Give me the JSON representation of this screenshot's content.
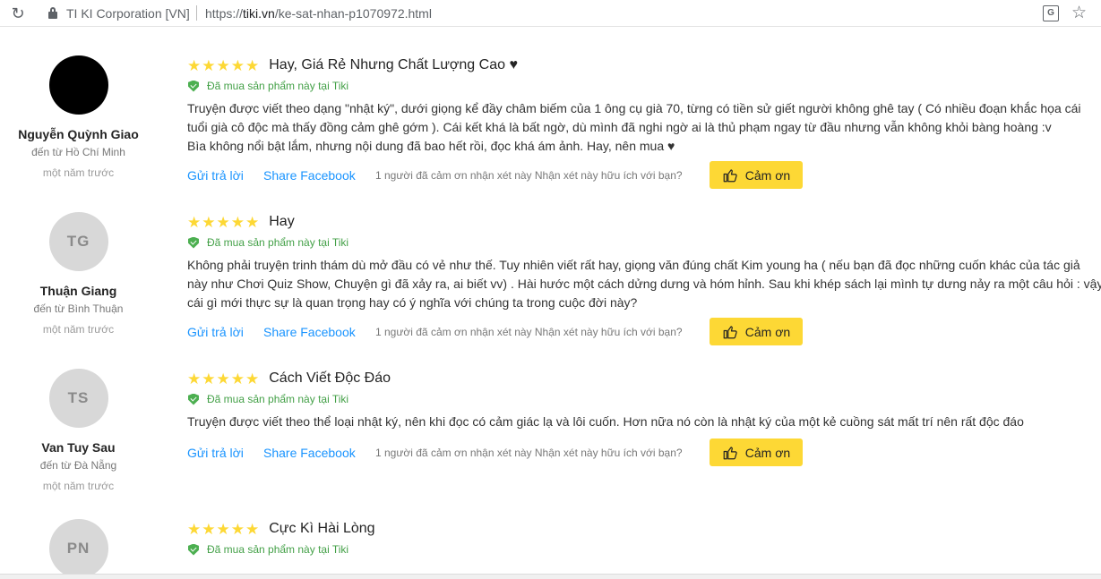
{
  "browser": {
    "site_name": "TI KI Corporation [VN]",
    "url_prefix": "https://",
    "url_host": "tiki.vn",
    "url_path": "/ke-sat-nhan-p1070972.html"
  },
  "labels": {
    "verified": "Đã mua sản phẩm này tại Tiki",
    "reply": "Gửi trả lời",
    "share": "Share Facebook",
    "thanks_button": "Cảm ơn"
  },
  "reviews": [
    {
      "author_initials": "",
      "author_name": "Nguyễn Quỳnh Giao",
      "author_from": "đến từ Hồ Chí Minh",
      "date": "một năm trước",
      "stars": "★★★★★",
      "rating": 5,
      "title": "Hay, Giá Rẻ Nhưng Chất Lượng Cao ♥",
      "body_lines": [
        "Truyện được viết theo dạng \"nhật ký\", dưới giọng kể đầy châm biếm của 1 ông cụ già 70, từng có tiền sử giết người không ghê tay ( Có nhiều đoạn khắc họa cái",
        "tuổi già cô độc mà thấy đồng cảm ghê gớm ). Cái kết khá là bất ngờ, dù mình đã nghi ngờ ai là thủ phạm ngay từ đầu nhưng vẫn không khỏi bàng hoàng :v",
        "Bìa không nổi bật lắm, nhưng nội dung đã bao hết rồi, đọc khá ám ảnh. Hay, nên mua ♥"
      ],
      "thanks_info": "1 người đã cảm ơn nhận xét này Nhận xét này hữu ích với bạn?"
    },
    {
      "author_initials": "TG",
      "author_name": "Thuận Giang",
      "author_from": "đến từ Bình Thuận",
      "date": "một năm trước",
      "stars": "★★★★★",
      "rating": 5,
      "title": "Hay",
      "body_lines": [
        "Không phải truyện trinh thám dù mở đầu có vẻ như thế. Tuy nhiên viết rất hay, giọng văn đúng chất Kim young ha ( nếu bạn đã đọc những cuốn khác của tác giả",
        "này như Chơi Quiz Show, Chuyện gì đã xảy ra, ai biết vv) . Hài hước một cách dửng dưng và hóm hỉnh. Sau khi khép sách lại mình tự dưng nảy ra một câu hỏi : vậy",
        "cái gì mới thực sự là quan trọng hay có ý nghĩa với chúng ta trong cuộc đời này?"
      ],
      "thanks_info": "1 người đã cảm ơn nhận xét này Nhận xét này hữu ích với bạn?"
    },
    {
      "author_initials": "TS",
      "author_name": "Van Tuy Sau",
      "author_from": "đến từ Đà Nẵng",
      "date": "một năm trước",
      "stars": "★★★★★",
      "rating": 5,
      "title": "Cách Viết Độc Đáo",
      "body_lines": [
        "Truyện được viết theo thể loại nhật ký, nên khi đọc có cảm giác lạ và lôi cuốn. Hơn nữa nó còn là nhật ký của một kẻ cuồng sát mất trí nên rất độc đáo"
      ],
      "thanks_info": "1 người đã cảm ơn nhận xét này Nhận xét này hữu ích với bạn?"
    },
    {
      "author_initials": "PN",
      "stars": "★★★★★",
      "rating": 5,
      "title": "Cực Kì Hài Lòng"
    }
  ]
}
